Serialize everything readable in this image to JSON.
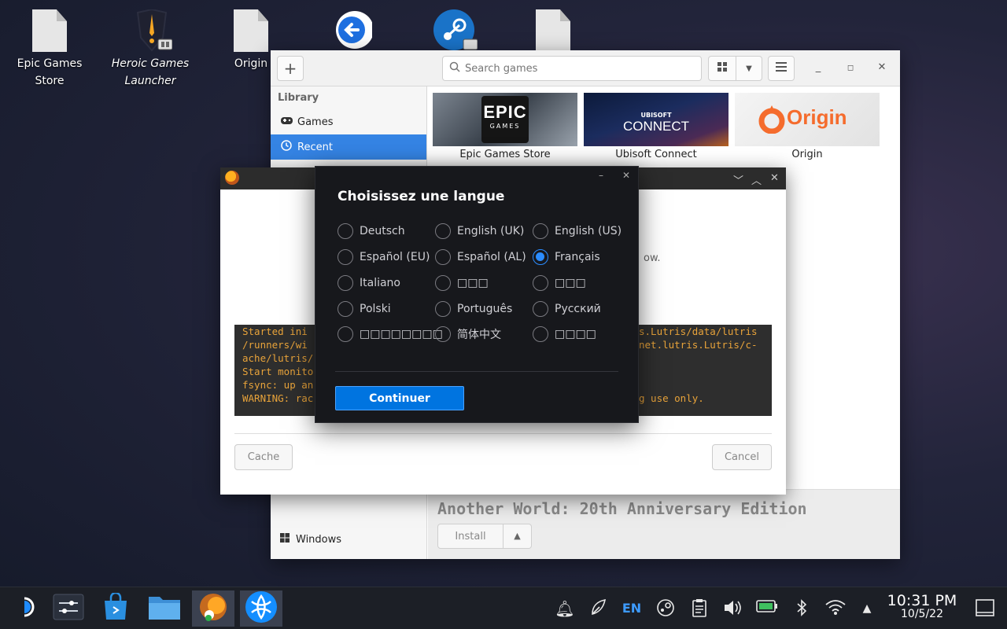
{
  "desktop": {
    "icons": [
      {
        "label": "Epic Games Store",
        "style": "normal"
      },
      {
        "label": "Heroic Games Launcher",
        "style": "italic"
      },
      {
        "label": "Origin",
        "style": "normal"
      }
    ]
  },
  "lutris": {
    "search_placeholder": "Search games",
    "sidebar": {
      "header": "Library",
      "items": [
        {
          "label": "Games",
          "icon": "gamepad-icon"
        },
        {
          "label": "Recent",
          "icon": "clock-icon",
          "active": true
        }
      ],
      "platform_item": "Windows"
    },
    "games": [
      {
        "name": "Epic Games Store",
        "banner_text": "EPIC",
        "banner_sub": "GAMES"
      },
      {
        "name": "Ubisoft Connect",
        "banner_text": "CONNECT",
        "banner_sub": "UBISOFT"
      },
      {
        "name": "Origin",
        "banner_text": "Origin"
      }
    ],
    "selected_game_title": "Another World: 20th Anniversary Edition",
    "install_label": "Install"
  },
  "install_dialog": {
    "partial_text": "ow.",
    "terminal": {
      "left_lines": [
        "Started ini",
        "/runners/wi",
        "ache/lutris/",
        "Start monito",
        "fsync: up an",
        "WARNING: rac"
      ],
      "right_lines": [
        "s.Lutris/data/lutris",
        "net.lutris.Lutris/c-",
        "",
        "",
        "",
        "g use only."
      ]
    },
    "cache_label": "Cache",
    "cancel_label": "Cancel"
  },
  "language_dialog": {
    "title": "Choisissez une langue",
    "options": [
      [
        "Deutsch",
        "English (UK)",
        "English (US)"
      ],
      [
        "Español (EU)",
        "Español (AL)",
        "Français"
      ],
      [
        "Italiano",
        "□□□",
        "□□□"
      ],
      [
        "Polski",
        "Português",
        "Русский"
      ],
      [
        "□□□□□□□□",
        "简体中文",
        "□□□□"
      ]
    ],
    "selected": "Français",
    "continue_label": "Continuer"
  },
  "taskbar": {
    "keyboard_layout": "EN",
    "time": "10:31 PM",
    "date": "10/5/22"
  },
  "colors": {
    "accent": "#3584e4",
    "dialog_bg": "#17181c",
    "continue_blue": "#0074e0",
    "terminal_text": "#e8a33a"
  }
}
